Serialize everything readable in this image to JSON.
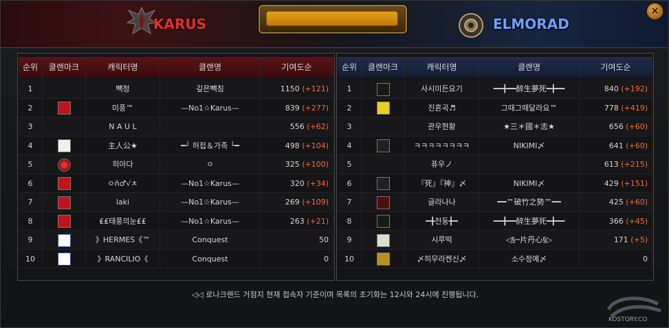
{
  "factions": {
    "karus": "KARUS",
    "elmorad": "ELMORAD"
  },
  "columns": [
    "순위",
    "클랜마크",
    "캐릭터명",
    "클랜명",
    "기여도순"
  ],
  "karus_rows": [
    {
      "rank": "1",
      "mark": "",
      "char": "빽청",
      "clan": "깊은빽침",
      "points": "1150",
      "delta": "(+121)"
    },
    {
      "rank": "2",
      "mark": "red-clan-mark",
      "char": "미풍™",
      "clan": "—No1☆Karus—",
      "points": "839",
      "delta": "(+277)"
    },
    {
      "rank": "3",
      "mark": "",
      "char": "N A U L",
      "clan": "",
      "points": "556",
      "delta": "(+62)"
    },
    {
      "rank": "4",
      "mark": "white-clan-mark",
      "char": "主人公★",
      "clan": "━┘ 허접＆가족 └━",
      "points": "498",
      "delta": "(+104)"
    },
    {
      "rank": "5",
      "mark": "red-orb-mark",
      "char": "히아다",
      "clan": "ㅇ",
      "points": "325",
      "delta": "(+100)"
    },
    {
      "rank": "6",
      "mark": "red-clan-mark",
      "char": "ㅇñ♂√ㅊ",
      "clan": "—No1☆Karus—",
      "points": "320",
      "delta": "(+34)"
    },
    {
      "rank": "7",
      "mark": "red-clan-mark",
      "char": "laki",
      "clan": "—No1☆Karus—",
      "points": "269",
      "delta": "(+109)"
    },
    {
      "rank": "8",
      "mark": "red-clan-mark",
      "char": "₤₤태풍의눈₤₤",
      "clan": "—No1☆Karus—",
      "points": "263",
      "delta": "(+21)"
    },
    {
      "rank": "9",
      "mark": "blue-c-mark",
      "char": "》HERMES《™",
      "clan": "Conquest",
      "points": "50",
      "delta": ""
    },
    {
      "rank": "10",
      "mark": "blue-c-mark",
      "char": "》RANCILIO《",
      "clan": "Conquest",
      "points": "0",
      "delta": ""
    }
  ],
  "elmorad_rows": [
    {
      "rank": "1",
      "mark": "yellow-script-mark",
      "char": "사시미든요기",
      "clan": "━━╋━━醉生夢死━╋━━",
      "points": "840",
      "delta": "(+192)"
    },
    {
      "rank": "2",
      "mark": "yellow-text-mark",
      "char": "진혼곡♬",
      "clan": "그때그때달라요™",
      "points": "778",
      "delta": "(+419)"
    },
    {
      "rank": "3",
      "mark": "",
      "char": "관우현황",
      "clan": "★三＊國＊志★",
      "points": "656",
      "delta": "(+60)"
    },
    {
      "rank": "4",
      "mark": "castle-mark",
      "char": "ㅋㅋㅋㅋㅋㅋㅋㅋ",
      "clan": "NIKIMI〆",
      "points": "641",
      "delta": "(+60)"
    },
    {
      "rank": "5",
      "mark": "",
      "char": "퓨우ノ",
      "clan": "",
      "points": "613",
      "delta": "(+215)"
    },
    {
      "rank": "6",
      "mark": "castle-mark",
      "char": "『死』『神』〆",
      "clan": "NIKIMI〆",
      "points": "429",
      "delta": "(+151)"
    },
    {
      "rank": "7",
      "mark": "red-sun-mark",
      "char": "글라나나",
      "clan": "━━™破竹之勢™━━",
      "points": "425",
      "delta": "(+60)"
    },
    {
      "rank": "8",
      "mark": "yellow-script-mark",
      "char": "━╋천둥╋━",
      "clan": "━━╋━━醉生夢死━╋━━",
      "points": "366",
      "delta": "(+45)"
    },
    {
      "rank": "9",
      "mark": "flower-mark",
      "char": "시루떡",
      "clan": "◁§─片丹心§▷",
      "points": "171",
      "delta": "(+5)"
    },
    {
      "rank": "10",
      "mark": "gold-kanji-mark",
      "char": "〆히무라켄신〆",
      "clan": "소수정예〆",
      "points": "0",
      "delta": ""
    }
  ],
  "notice": "◁◁ 로나크랜드 거점지 현재 접속자 기준이며 목록의 초기화는 12시와 24시에 진행됩니다.",
  "watermark": "KOSTORY.CO",
  "colors": {
    "karus": "#e0312f",
    "elmorad": "#6fa0ff",
    "delta": "#ff6a2a"
  }
}
